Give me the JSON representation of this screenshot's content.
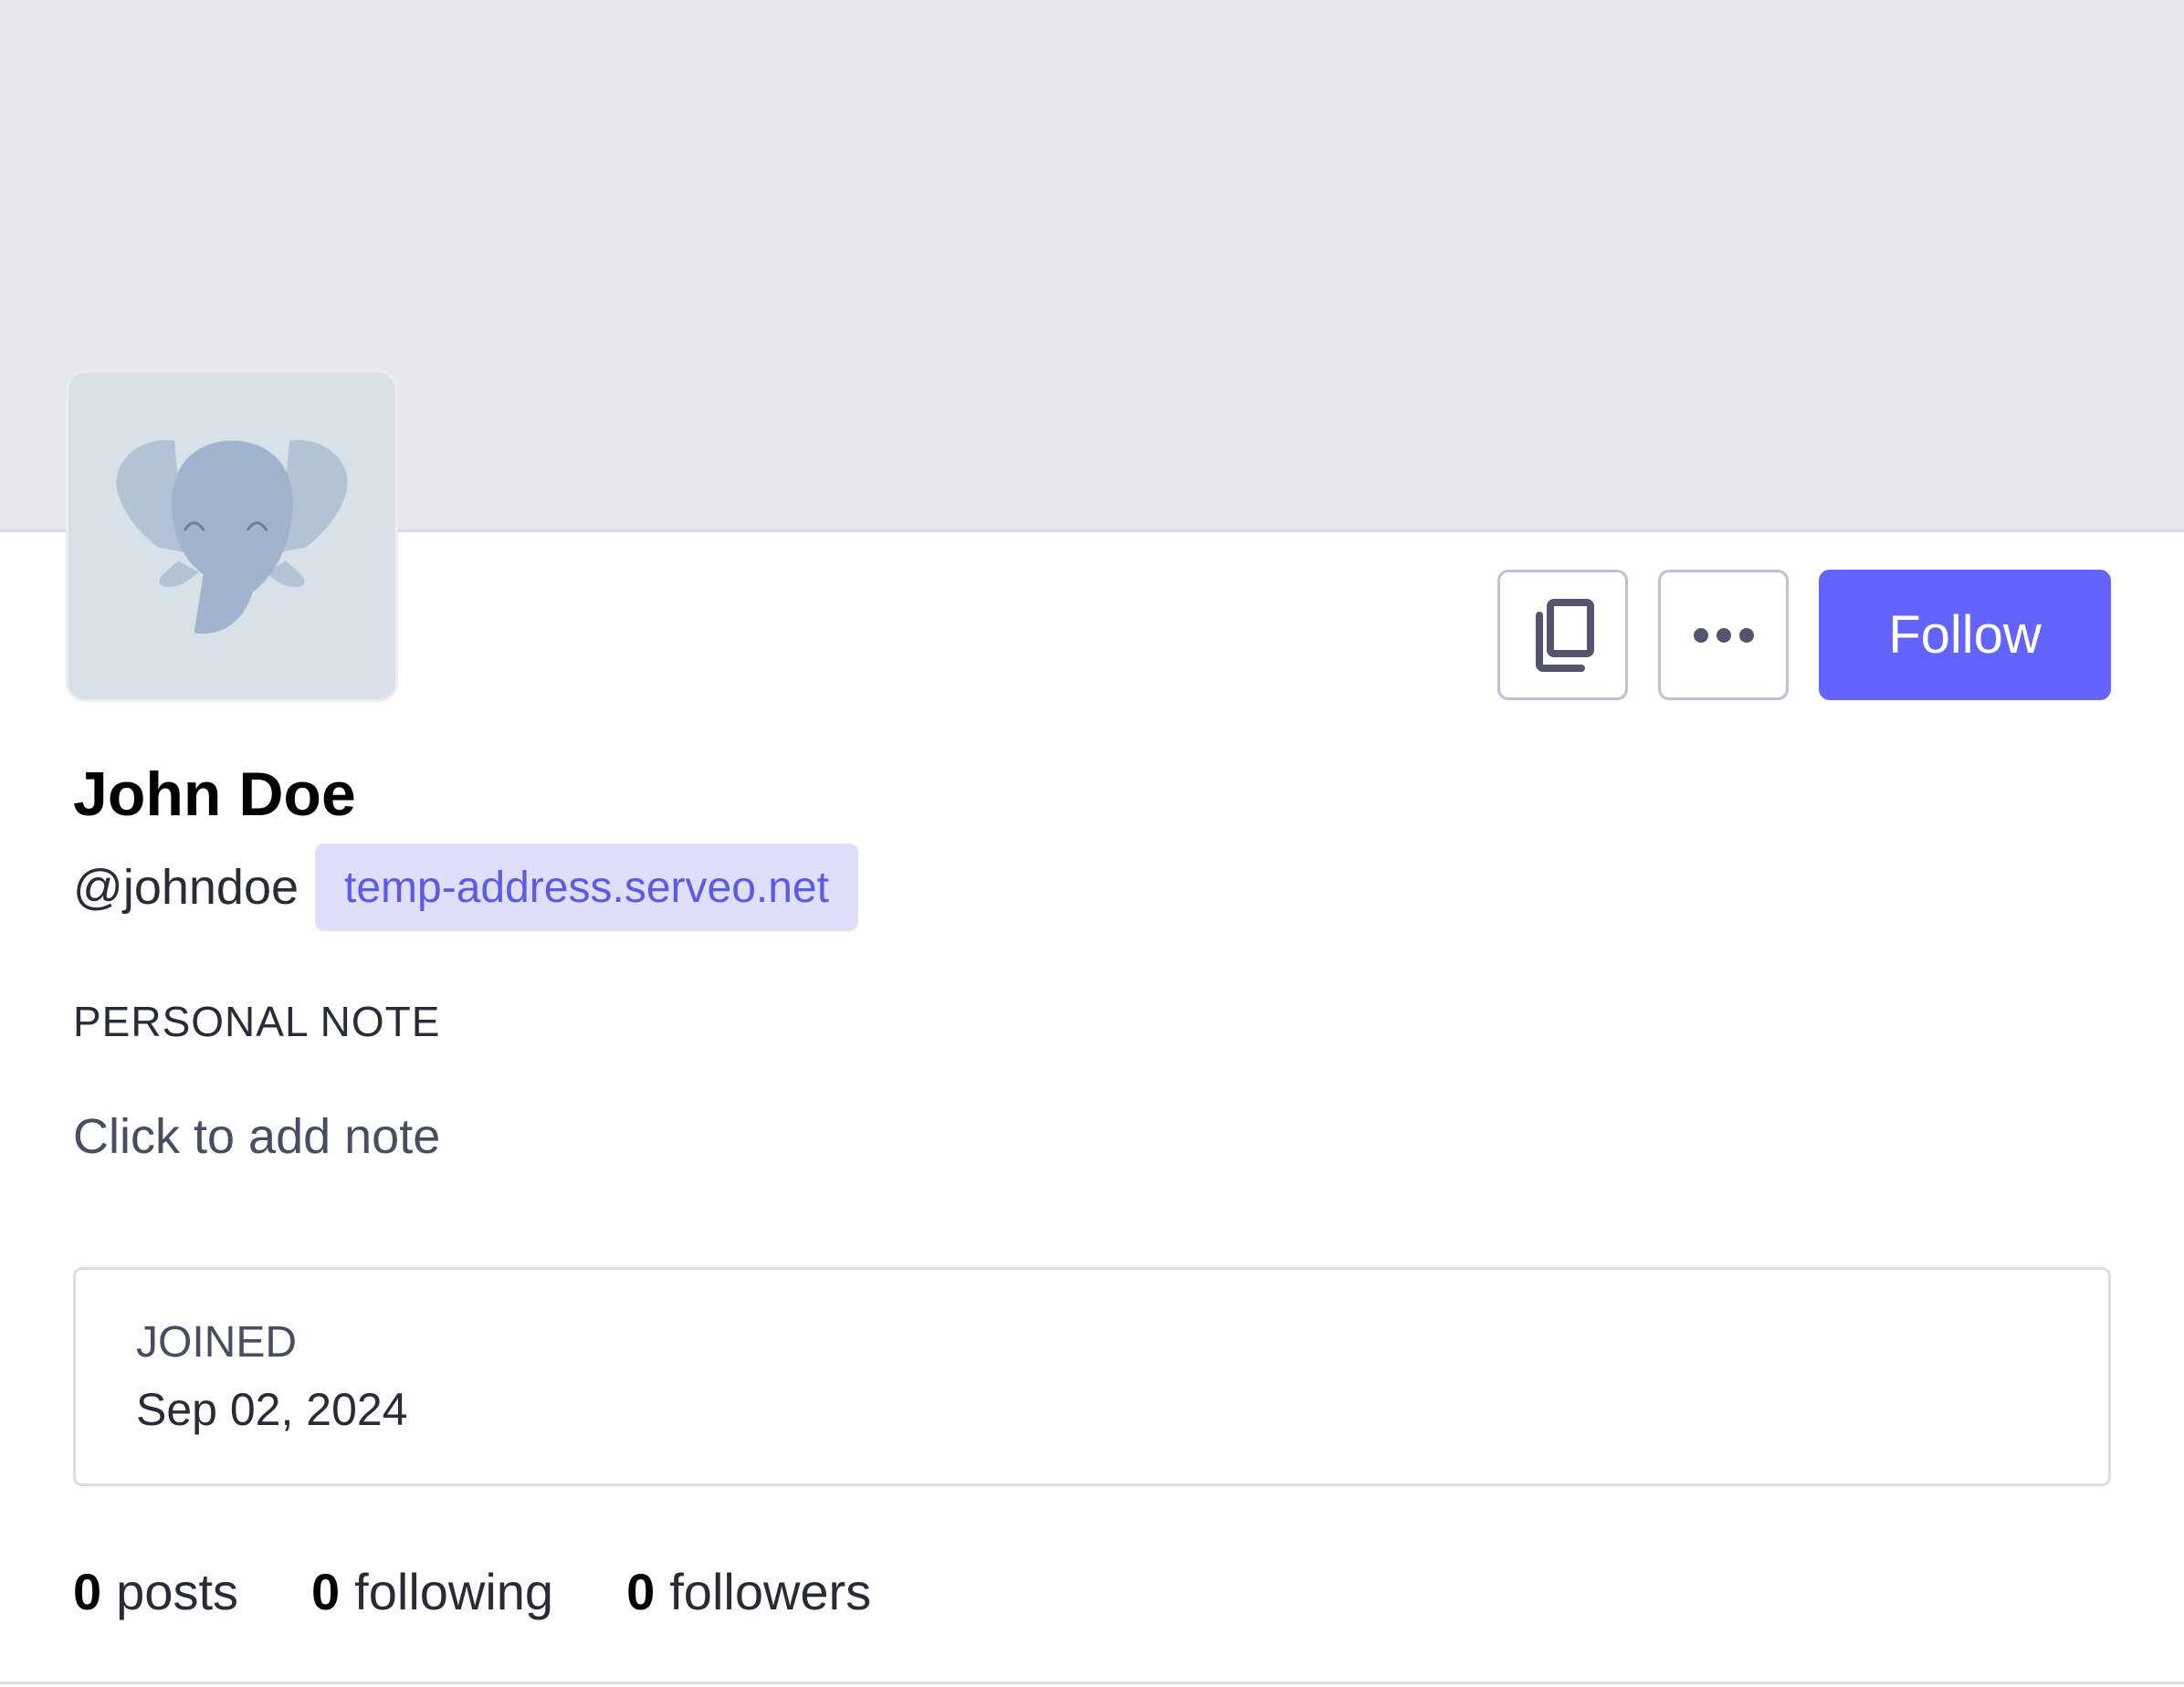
{
  "profile": {
    "display_name": "John Doe",
    "handle": "@johndoe",
    "domain": "temp-address.serveo.net"
  },
  "actions": {
    "copy_icon": "copy-icon",
    "more_icon": "more-horizontal-icon",
    "follow_label": "Follow"
  },
  "note": {
    "label": "PERSONAL NOTE",
    "placeholder": "Click to add note"
  },
  "joined": {
    "label": "JOINED",
    "date": "Sep 02, 2024"
  },
  "stats": {
    "posts": {
      "count": "0",
      "label": "posts"
    },
    "following": {
      "count": "0",
      "label": "following"
    },
    "followers": {
      "count": "0",
      "label": "followers"
    }
  },
  "colors": {
    "accent": "#6364ff",
    "banner": "#e7e6f1",
    "badge_bg": "#dfdffc",
    "badge_text": "#5a5be8"
  }
}
